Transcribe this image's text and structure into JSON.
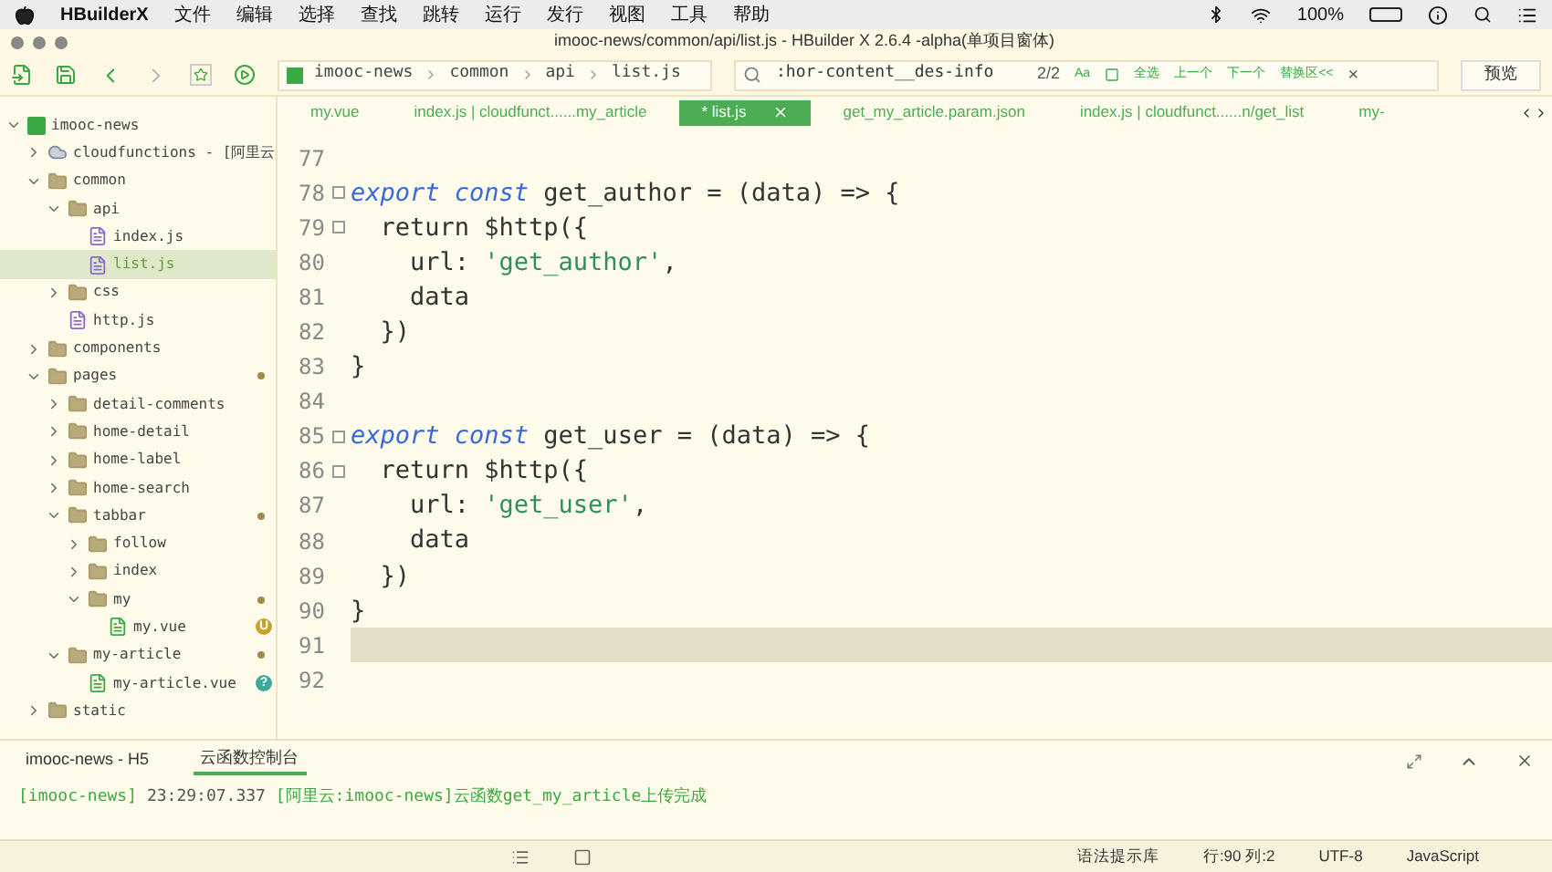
{
  "menubar": {
    "app": "HBuilderX",
    "menus": [
      "文件",
      "编辑",
      "选择",
      "查找",
      "跳转",
      "运行",
      "发行",
      "视图",
      "工具",
      "帮助"
    ],
    "battery": "100%"
  },
  "window": {
    "title": "imooc-news/common/api/list.js - HBuilder X 2.6.4 -alpha(单项目窗体)"
  },
  "breadcrumb": [
    "imooc-news",
    "common",
    "api",
    "list.js"
  ],
  "find": {
    "value": ":hor-content__des-info",
    "count": "2/2",
    "case": "Aa",
    "actions": [
      "全选",
      "上一个",
      "下一个",
      "替换区<<"
    ],
    "close": "×"
  },
  "preview_button": "预览",
  "tree": [
    {
      "label": "imooc-news",
      "kind": "project",
      "expanded": true,
      "selected": false,
      "children": [
        {
          "label": "cloudfunctions - [阿里云",
          "kind": "cloud",
          "expanded": false,
          "selected": false
        },
        {
          "label": "common",
          "kind": "folder",
          "expanded": true,
          "selected": false,
          "children": [
            {
              "label": "api",
              "kind": "folder",
              "expanded": true,
              "selected": false,
              "children": [
                {
                  "label": "index.js",
                  "kind": "file",
                  "selected": false
                },
                {
                  "label": "list.js",
                  "kind": "file",
                  "selected": true
                }
              ]
            },
            {
              "label": "css",
              "kind": "folder",
              "expanded": false,
              "selected": false
            },
            {
              "label": "http.js",
              "kind": "file",
              "selected": false
            }
          ]
        },
        {
          "label": "components",
          "kind": "folder",
          "expanded": false,
          "selected": false
        },
        {
          "label": "pages",
          "kind": "folder",
          "expanded": true,
          "selected": false,
          "dot": true,
          "children": [
            {
              "label": "detail-comments",
              "kind": "folder",
              "expanded": false,
              "selected": false
            },
            {
              "label": "home-detail",
              "kind": "folder",
              "expanded": false,
              "selected": false
            },
            {
              "label": "home-label",
              "kind": "folder",
              "expanded": false,
              "selected": false
            },
            {
              "label": "home-search",
              "kind": "folder",
              "expanded": false,
              "selected": false
            },
            {
              "label": "tabbar",
              "kind": "folder",
              "expanded": true,
              "selected": false,
              "dot": true,
              "children": [
                {
                  "label": "follow",
                  "kind": "folder",
                  "expanded": false,
                  "selected": false
                },
                {
                  "label": "index",
                  "kind": "folder",
                  "expanded": false,
                  "selected": false
                },
                {
                  "label": "my",
                  "kind": "folder",
                  "expanded": true,
                  "selected": false,
                  "dot": true,
                  "children": [
                    {
                      "label": "my.vue",
                      "kind": "vue",
                      "selected": false,
                      "badge": {
                        "text": "U",
                        "color": "#c9a227"
                      }
                    }
                  ]
                }
              ]
            },
            {
              "label": "my-article",
              "kind": "folder",
              "expanded": true,
              "selected": false,
              "dot": true,
              "children": [
                {
                  "label": "my-article.vue",
                  "kind": "vue",
                  "selected": false,
                  "badge": {
                    "text": "?",
                    "color": "#3aa89a"
                  }
                }
              ]
            }
          ]
        },
        {
          "label": "static",
          "kind": "folder",
          "expanded": false,
          "selected": false
        }
      ]
    }
  ],
  "tabs": [
    {
      "label": "my.vue",
      "selected": false
    },
    {
      "label": "index.js | cloudfunct......my_article",
      "selected": false
    },
    {
      "label": "* list.js",
      "selected": true
    },
    {
      "label": "get_my_article.param.json",
      "selected": false
    },
    {
      "label": "index.js | cloudfunct......n/get_list",
      "selected": false
    },
    {
      "label": "my-",
      "selected": false
    }
  ],
  "code": [
    {
      "number": "77",
      "fold": false,
      "current": false
    },
    {
      "number": "78",
      "fold": true,
      "current": false,
      "tokens": [
        {
          "kind": "keyword",
          "text": "export const"
        },
        {
          "kind": "plain",
          "text": " get_author = (data) => {"
        }
      ]
    },
    {
      "number": "79",
      "fold": true,
      "current": false,
      "tokens": [
        {
          "kind": "plain",
          "text": "  return $http({"
        }
      ]
    },
    {
      "number": "80",
      "fold": false,
      "current": false,
      "tokens": [
        {
          "kind": "plain",
          "text": "    url: "
        },
        {
          "kind": "string",
          "text": "'get_author'"
        },
        {
          "kind": "plain",
          "text": ","
        }
      ]
    },
    {
      "number": "81",
      "fold": false,
      "current": false,
      "tokens": [
        {
          "kind": "plain",
          "text": "    data"
        }
      ]
    },
    {
      "number": "82",
      "fold": false,
      "current": false,
      "tokens": [
        {
          "kind": "plain",
          "text": "  })"
        }
      ]
    },
    {
      "number": "83",
      "fold": false,
      "current": false,
      "tokens": [
        {
          "kind": "plain",
          "text": "}"
        }
      ]
    },
    {
      "number": "84",
      "fold": false,
      "current": false
    },
    {
      "number": "85",
      "fold": true,
      "current": false,
      "tokens": [
        {
          "kind": "keyword",
          "text": "export const"
        },
        {
          "kind": "plain",
          "text": " get_user = (data) => {"
        }
      ]
    },
    {
      "number": "86",
      "fold": true,
      "current": false,
      "tokens": [
        {
          "kind": "plain",
          "text": "  return $http({"
        }
      ]
    },
    {
      "number": "87",
      "fold": false,
      "current": false,
      "tokens": [
        {
          "kind": "plain",
          "text": "    url: "
        },
        {
          "kind": "string",
          "text": "'get_user'"
        },
        {
          "kind": "plain",
          "text": ","
        }
      ]
    },
    {
      "number": "88",
      "fold": false,
      "current": false,
      "tokens": [
        {
          "kind": "plain",
          "text": "    data"
        }
      ]
    },
    {
      "number": "89",
      "fold": false,
      "current": false,
      "tokens": [
        {
          "kind": "plain",
          "text": "  })"
        }
      ]
    },
    {
      "number": "90",
      "fold": false,
      "current": false,
      "tokens": [
        {
          "kind": "plain",
          "text": "}"
        }
      ]
    },
    {
      "number": "91",
      "fold": false,
      "current": true
    },
    {
      "number": "92",
      "fold": false,
      "current": false
    }
  ],
  "console": {
    "tabs": [
      {
        "label": "imooc-news - H5",
        "selected": false
      },
      {
        "label": "云函数控制台",
        "selected": true
      }
    ],
    "log": [
      {
        "kind": "tag",
        "text": "[imooc-news]"
      },
      {
        "kind": "time",
        "text": " 23:29:07.337 "
      },
      {
        "kind": "tag",
        "text": "[阿里云:imooc-news]云函数get_my_article上传完成"
      }
    ]
  },
  "status_bar": {
    "hint": "语法提示库",
    "position": "行:90 列:2",
    "encoding": "UTF-8",
    "language": "JavaScript"
  }
}
